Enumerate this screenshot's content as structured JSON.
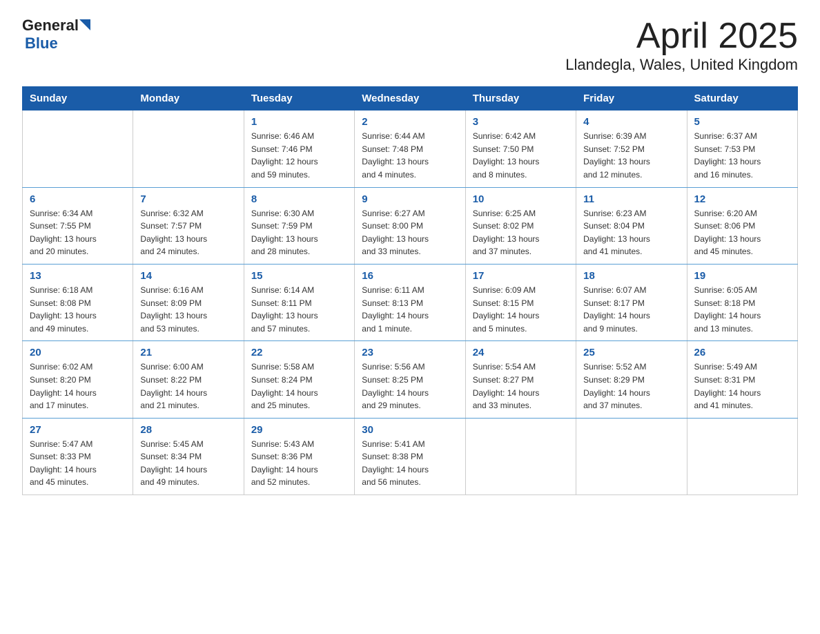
{
  "header": {
    "title": "April 2025",
    "subtitle": "Llandegla, Wales, United Kingdom",
    "logo_general": "General",
    "logo_blue": "Blue"
  },
  "days_of_week": [
    "Sunday",
    "Monday",
    "Tuesday",
    "Wednesday",
    "Thursday",
    "Friday",
    "Saturday"
  ],
  "weeks": [
    [
      {
        "num": "",
        "info": ""
      },
      {
        "num": "",
        "info": ""
      },
      {
        "num": "1",
        "info": "Sunrise: 6:46 AM\nSunset: 7:46 PM\nDaylight: 12 hours\nand 59 minutes."
      },
      {
        "num": "2",
        "info": "Sunrise: 6:44 AM\nSunset: 7:48 PM\nDaylight: 13 hours\nand 4 minutes."
      },
      {
        "num": "3",
        "info": "Sunrise: 6:42 AM\nSunset: 7:50 PM\nDaylight: 13 hours\nand 8 minutes."
      },
      {
        "num": "4",
        "info": "Sunrise: 6:39 AM\nSunset: 7:52 PM\nDaylight: 13 hours\nand 12 minutes."
      },
      {
        "num": "5",
        "info": "Sunrise: 6:37 AM\nSunset: 7:53 PM\nDaylight: 13 hours\nand 16 minutes."
      }
    ],
    [
      {
        "num": "6",
        "info": "Sunrise: 6:34 AM\nSunset: 7:55 PM\nDaylight: 13 hours\nand 20 minutes."
      },
      {
        "num": "7",
        "info": "Sunrise: 6:32 AM\nSunset: 7:57 PM\nDaylight: 13 hours\nand 24 minutes."
      },
      {
        "num": "8",
        "info": "Sunrise: 6:30 AM\nSunset: 7:59 PM\nDaylight: 13 hours\nand 28 minutes."
      },
      {
        "num": "9",
        "info": "Sunrise: 6:27 AM\nSunset: 8:00 PM\nDaylight: 13 hours\nand 33 minutes."
      },
      {
        "num": "10",
        "info": "Sunrise: 6:25 AM\nSunset: 8:02 PM\nDaylight: 13 hours\nand 37 minutes."
      },
      {
        "num": "11",
        "info": "Sunrise: 6:23 AM\nSunset: 8:04 PM\nDaylight: 13 hours\nand 41 minutes."
      },
      {
        "num": "12",
        "info": "Sunrise: 6:20 AM\nSunset: 8:06 PM\nDaylight: 13 hours\nand 45 minutes."
      }
    ],
    [
      {
        "num": "13",
        "info": "Sunrise: 6:18 AM\nSunset: 8:08 PM\nDaylight: 13 hours\nand 49 minutes."
      },
      {
        "num": "14",
        "info": "Sunrise: 6:16 AM\nSunset: 8:09 PM\nDaylight: 13 hours\nand 53 minutes."
      },
      {
        "num": "15",
        "info": "Sunrise: 6:14 AM\nSunset: 8:11 PM\nDaylight: 13 hours\nand 57 minutes."
      },
      {
        "num": "16",
        "info": "Sunrise: 6:11 AM\nSunset: 8:13 PM\nDaylight: 14 hours\nand 1 minute."
      },
      {
        "num": "17",
        "info": "Sunrise: 6:09 AM\nSunset: 8:15 PM\nDaylight: 14 hours\nand 5 minutes."
      },
      {
        "num": "18",
        "info": "Sunrise: 6:07 AM\nSunset: 8:17 PM\nDaylight: 14 hours\nand 9 minutes."
      },
      {
        "num": "19",
        "info": "Sunrise: 6:05 AM\nSunset: 8:18 PM\nDaylight: 14 hours\nand 13 minutes."
      }
    ],
    [
      {
        "num": "20",
        "info": "Sunrise: 6:02 AM\nSunset: 8:20 PM\nDaylight: 14 hours\nand 17 minutes."
      },
      {
        "num": "21",
        "info": "Sunrise: 6:00 AM\nSunset: 8:22 PM\nDaylight: 14 hours\nand 21 minutes."
      },
      {
        "num": "22",
        "info": "Sunrise: 5:58 AM\nSunset: 8:24 PM\nDaylight: 14 hours\nand 25 minutes."
      },
      {
        "num": "23",
        "info": "Sunrise: 5:56 AM\nSunset: 8:25 PM\nDaylight: 14 hours\nand 29 minutes."
      },
      {
        "num": "24",
        "info": "Sunrise: 5:54 AM\nSunset: 8:27 PM\nDaylight: 14 hours\nand 33 minutes."
      },
      {
        "num": "25",
        "info": "Sunrise: 5:52 AM\nSunset: 8:29 PM\nDaylight: 14 hours\nand 37 minutes."
      },
      {
        "num": "26",
        "info": "Sunrise: 5:49 AM\nSunset: 8:31 PM\nDaylight: 14 hours\nand 41 minutes."
      }
    ],
    [
      {
        "num": "27",
        "info": "Sunrise: 5:47 AM\nSunset: 8:33 PM\nDaylight: 14 hours\nand 45 minutes."
      },
      {
        "num": "28",
        "info": "Sunrise: 5:45 AM\nSunset: 8:34 PM\nDaylight: 14 hours\nand 49 minutes."
      },
      {
        "num": "29",
        "info": "Sunrise: 5:43 AM\nSunset: 8:36 PM\nDaylight: 14 hours\nand 52 minutes."
      },
      {
        "num": "30",
        "info": "Sunrise: 5:41 AM\nSunset: 8:38 PM\nDaylight: 14 hours\nand 56 minutes."
      },
      {
        "num": "",
        "info": ""
      },
      {
        "num": "",
        "info": ""
      },
      {
        "num": "",
        "info": ""
      }
    ]
  ]
}
